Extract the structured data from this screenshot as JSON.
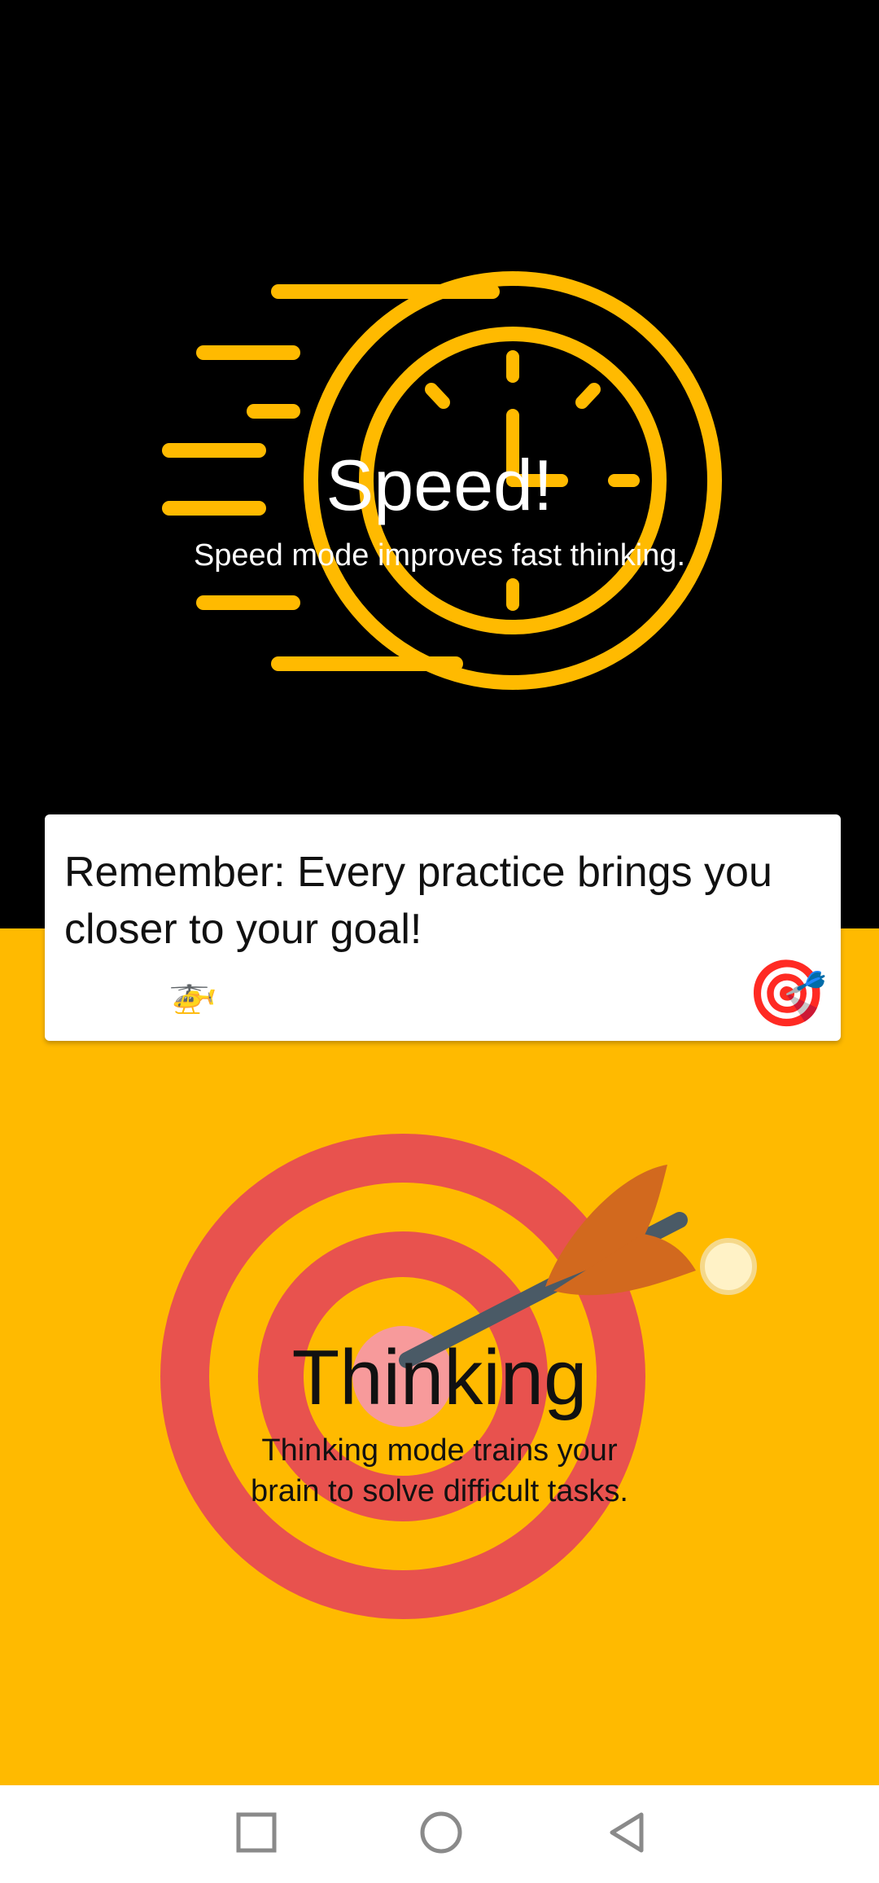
{
  "speed": {
    "title": "Speed!",
    "subtitle": "Speed mode improves fast thinking."
  },
  "card": {
    "text": "Remember: Every practice brings you closer to your goal!",
    "left_icon": "helicopter-icon",
    "right_icon": "target-icon"
  },
  "thinking": {
    "title": "Thinking",
    "subtitle_line1": "Thinking mode trains your",
    "subtitle_line2": "brain to solve difficult tasks."
  },
  "nav": {
    "recents_icon": "square-icon",
    "home_icon": "circle-icon",
    "back_icon": "triangle-back-icon"
  },
  "colors": {
    "accent": "#FFBA00",
    "target_red": "#E8524E",
    "target_light": "#F79A9B",
    "arrow_feather": "#D2691E",
    "arrow_shaft": "#4A5A66"
  }
}
